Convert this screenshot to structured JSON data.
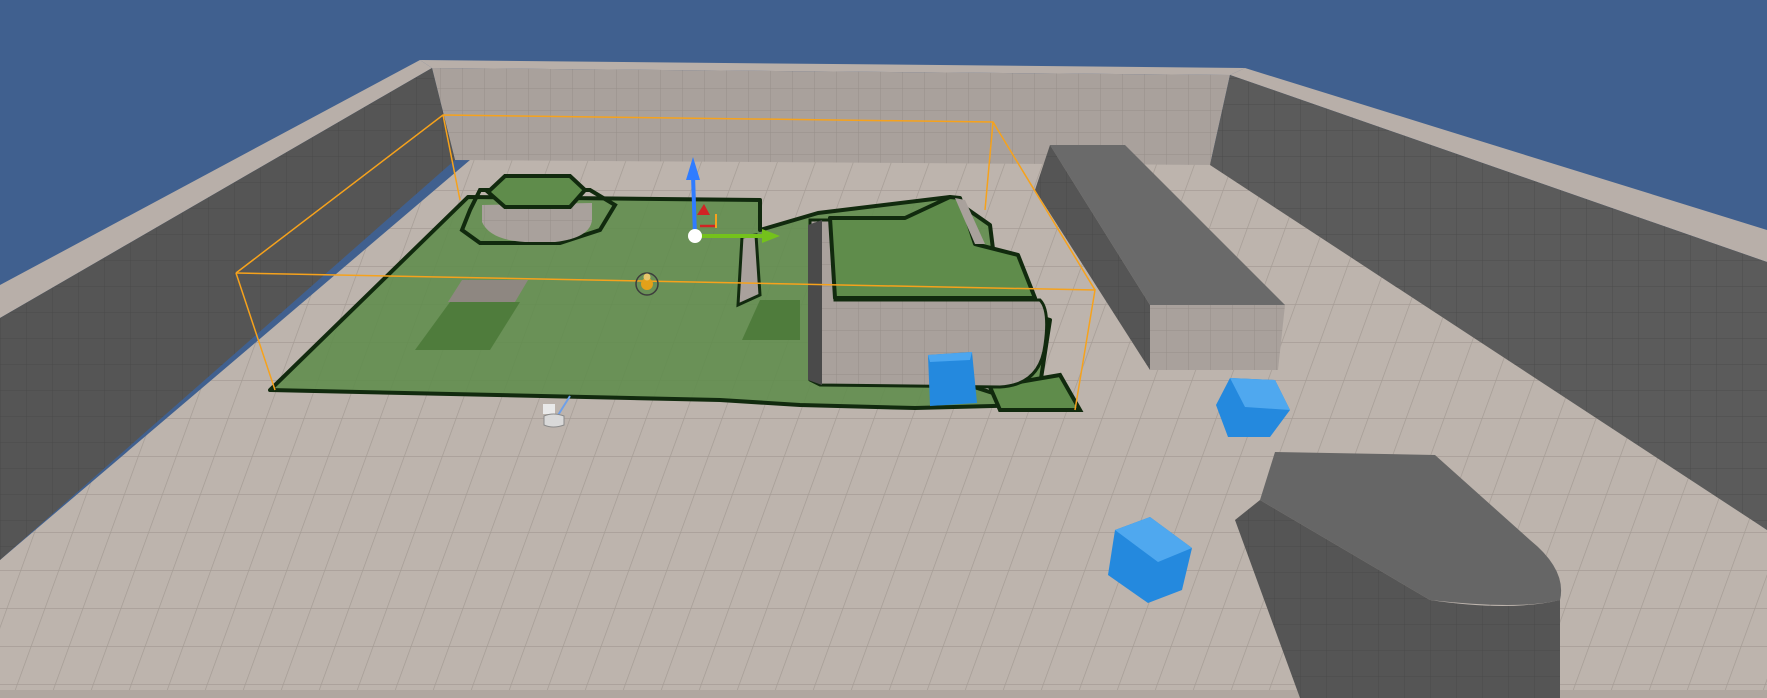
{
  "viewport": {
    "name": "level-editor-viewport",
    "sky_color": "#40608f",
    "floor_color": "#bdb4ad",
    "floor_grid_color": "#a59c95",
    "wall_top_color": "#b8afa9",
    "wall_face_dark": "#565656",
    "wall_face_light": "#aea6a1",
    "navmesh_color": "#5f8c4b",
    "navmesh_outline": "#112a0e",
    "bounds_color": "#f6a21c",
    "cube_color": "#2489de"
  },
  "gizmo": {
    "z_axis_color": "#2f7cff",
    "y_axis_color": "#74c21b",
    "x_axis_color": "#d12424",
    "pivot_color": "#ffffff"
  },
  "actors": {
    "player_start": "player-start-icon",
    "pawn": "character-pawn-icon",
    "cubes": [
      "cube",
      "cube",
      "cube"
    ]
  }
}
